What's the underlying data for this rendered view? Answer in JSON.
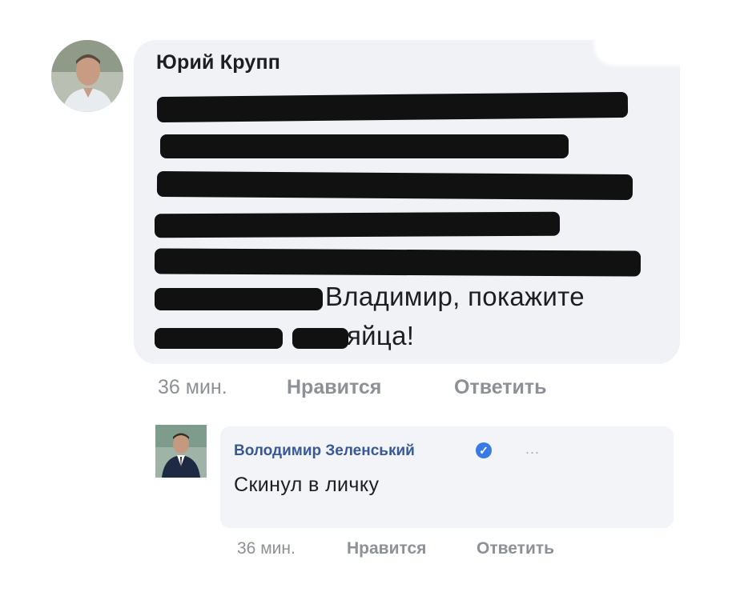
{
  "main_comment": {
    "author": "Юрий Крупп",
    "text_line_6_visible": "Владимир, покажите",
    "text_line_7_visible": "яйца!",
    "time": "36 мин.",
    "like_label": "Нравится",
    "reply_label": "Ответить"
  },
  "reply_comment": {
    "author": "Володимир Зеленський",
    "text": "Скинул в личку",
    "more_icon": "...",
    "time": "36 мин.",
    "like_label": "Нравится",
    "reply_label": "Ответить"
  },
  "colors": {
    "bubble": "#f0f2f6",
    "author_link": "#385898",
    "meta_gray": "#8d9197",
    "verified_blue": "#3a7ae5",
    "redaction": "#111111"
  },
  "icons": [
    "avatar",
    "verified-badge-icon",
    "more-options-icon"
  ]
}
